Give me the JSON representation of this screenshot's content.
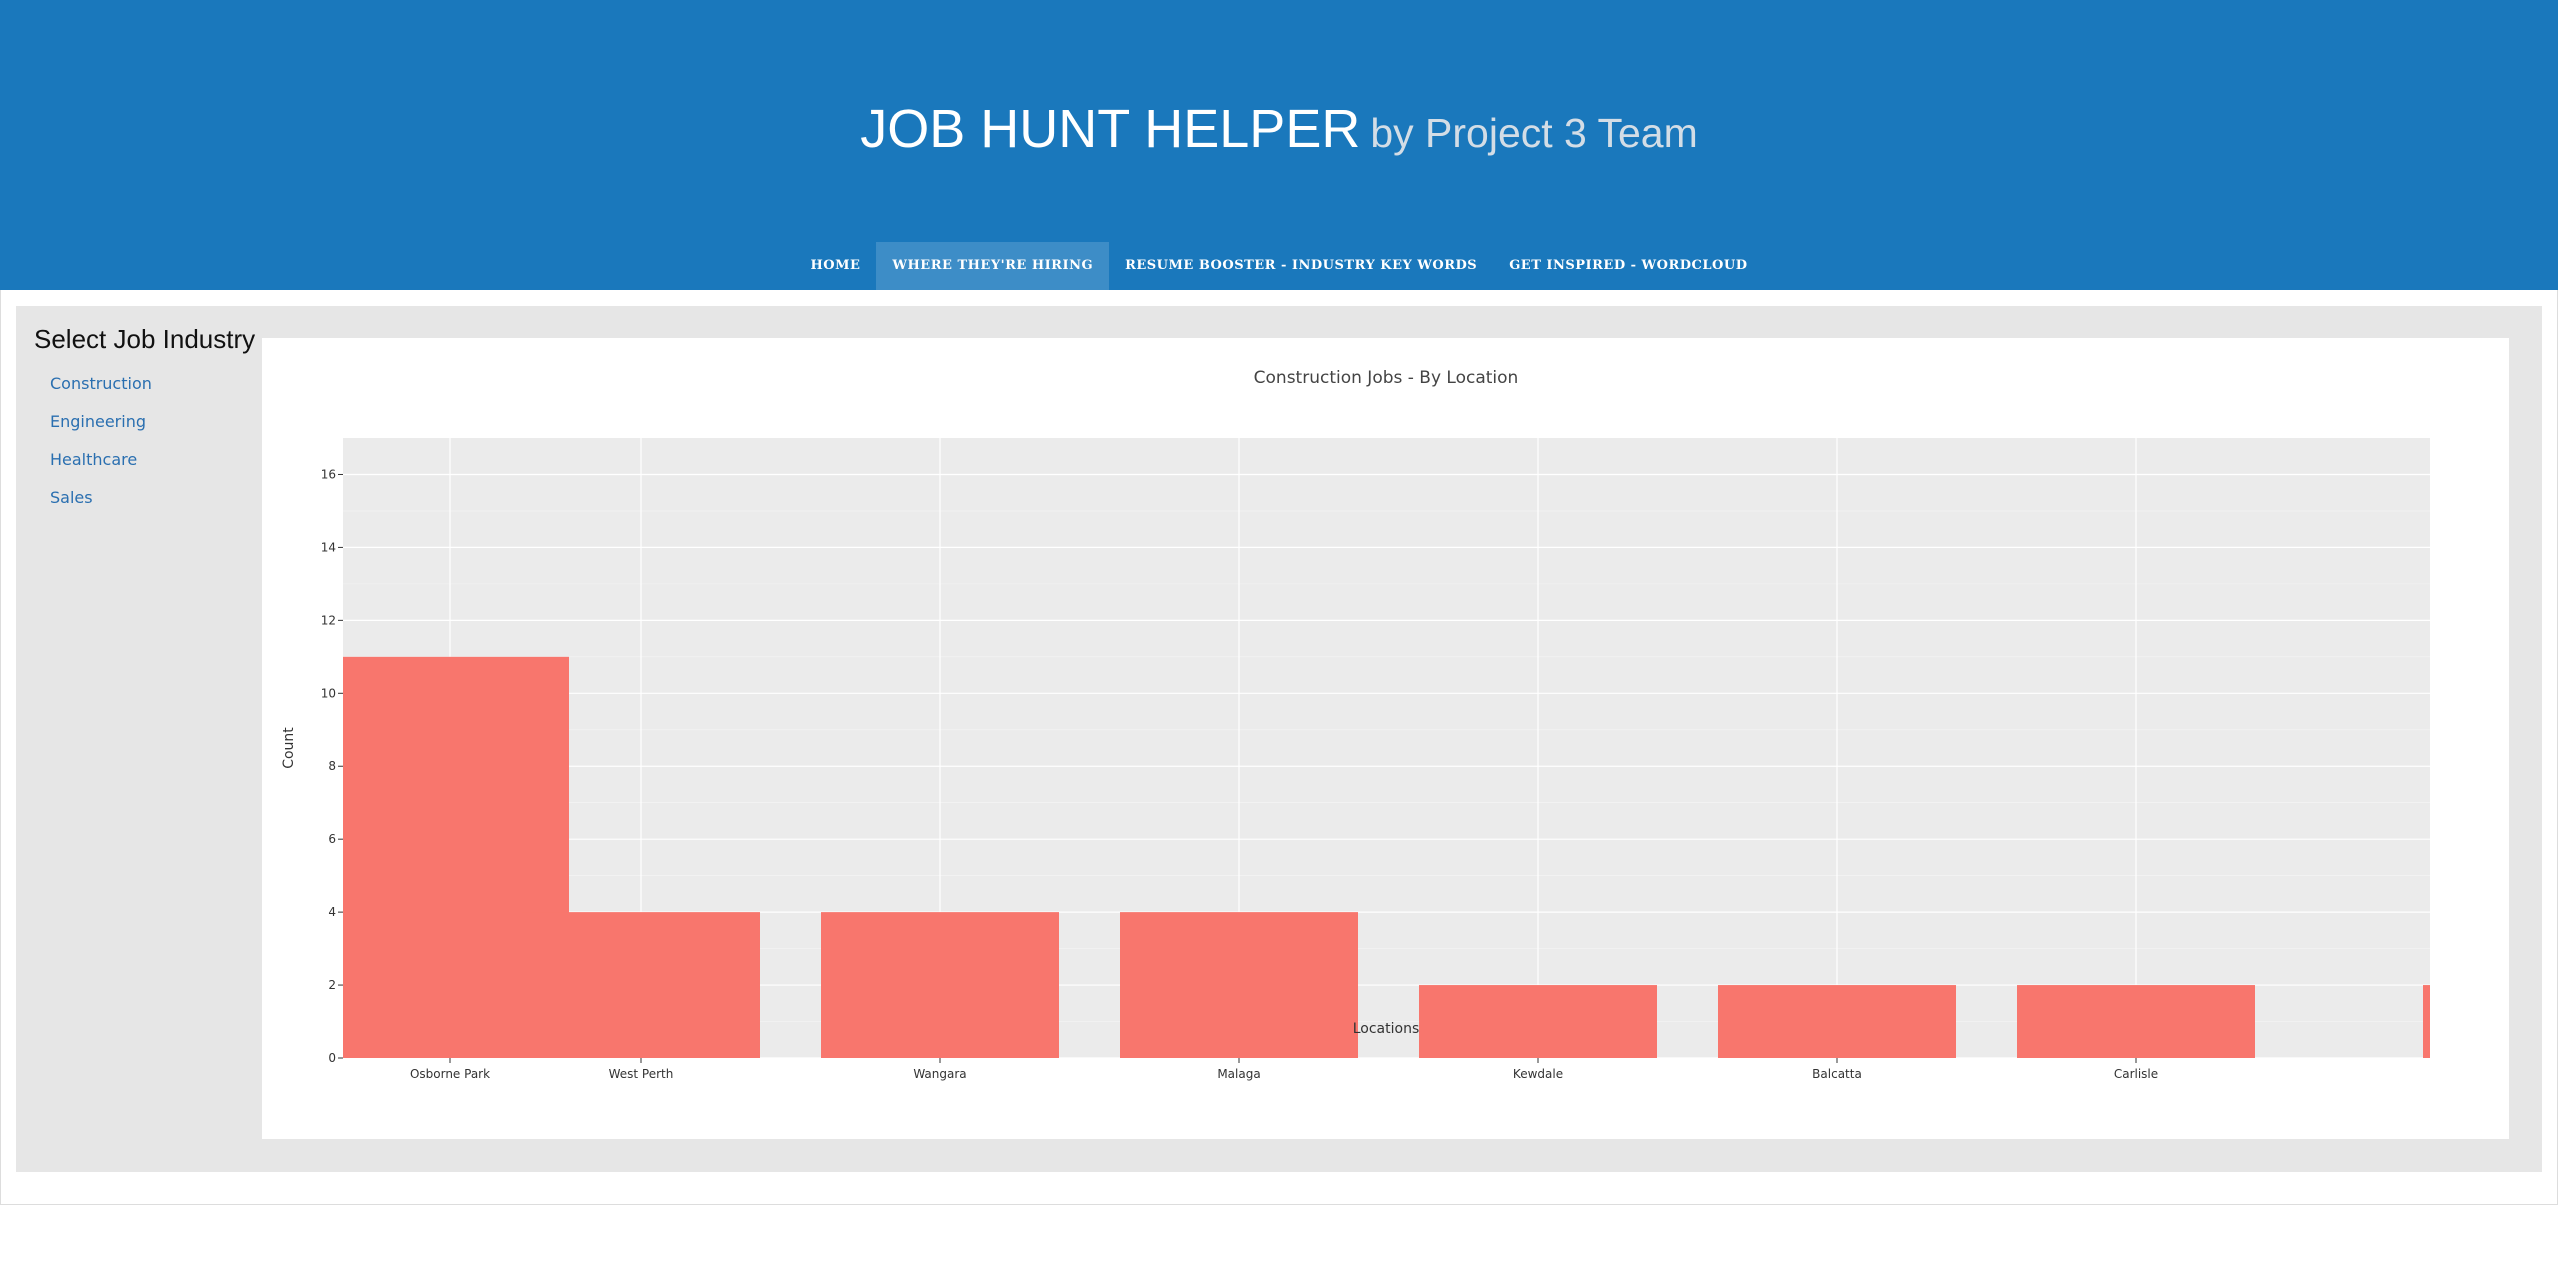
{
  "header": {
    "title": "JOB HUNT HELPER",
    "subtitle": "by Project 3 Team",
    "bg_color": "#1a78bc"
  },
  "nav": {
    "items": [
      {
        "label": "HOME",
        "active": false
      },
      {
        "label": "WHERE THEY'RE HIRING",
        "active": true
      },
      {
        "label": "RESUME BOOSTER - INDUSTRY KEY WORDS",
        "active": false
      },
      {
        "label": "GET INSPIRED - WORDCLOUD",
        "active": false
      }
    ]
  },
  "sidebar": {
    "title": "Select Job Industry",
    "links": [
      "Construction",
      "Engineering",
      "Healthcare",
      "Sales"
    ],
    "link_color": "#2a6fb0"
  },
  "chart_data": {
    "type": "bar",
    "title": "Construction Jobs - By Location",
    "xlabel": "Locations",
    "ylabel": "Count",
    "categories": [
      "Osborne Park",
      "West Perth",
      "Wangara",
      "Malaga",
      "Kewdale",
      "Balcatta",
      "Carlisle"
    ],
    "values": [
      11,
      4,
      4,
      4,
      2,
      2,
      2
    ],
    "ylim": [
      0,
      17
    ],
    "yticks": [
      0,
      2,
      4,
      6,
      8,
      10,
      12,
      14,
      16
    ],
    "bar_color": "#f8766d",
    "plot_bg": "#ebebeb",
    "grid": true,
    "legend": false
  }
}
